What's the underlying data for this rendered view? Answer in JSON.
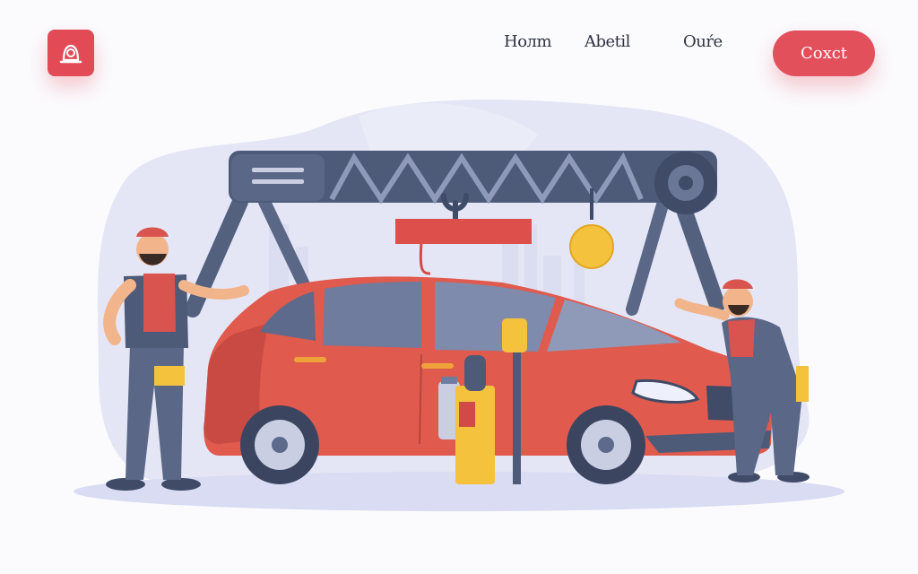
{
  "nav": {
    "logo_icon": "mechanic-helmet-icon",
    "links": [
      "Hoлm",
      "Abetil",
      "Ouŕe"
    ],
    "cta_label": "Coxct"
  },
  "colors": {
    "accent": "#e24a56",
    "car": "#e05a4e",
    "steel": "#4d5a78",
    "blob": "#e4e6f6",
    "yellow": "#f4c23c"
  },
  "hero": {
    "illustration": "car-repair-illustration",
    "sign_text": ""
  }
}
